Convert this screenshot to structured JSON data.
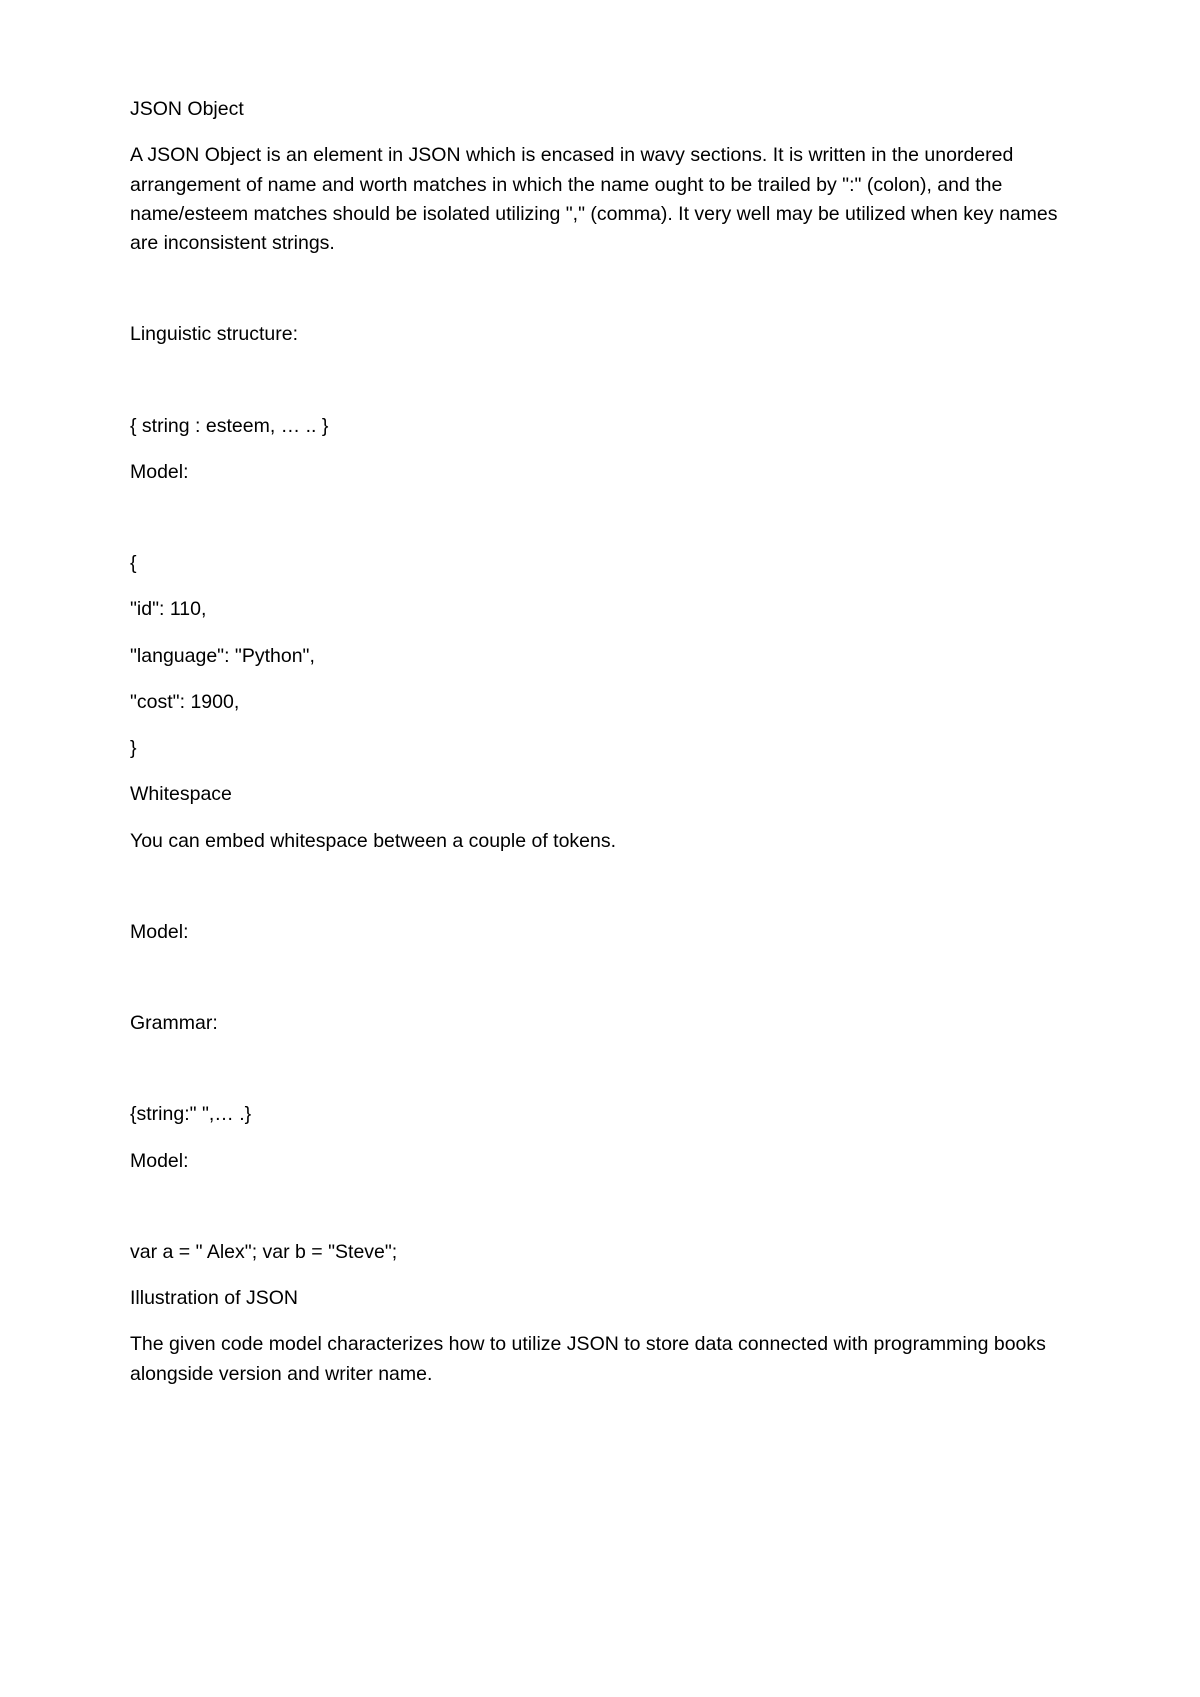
{
  "heading": "JSON Object",
  "intro": "A JSON Object is an element in JSON which is encased in wavy sections. It is written in the unordered arrangement of name and worth matches in which the name ought to be trailed by \":\" (colon), and the name/esteem matches should be isolated utilizing \",\" (comma). It very well may be utilized when key names are inconsistent strings.",
  "structure_label": "Linguistic structure:",
  "structure_syntax": "{ string : esteem, … .. }",
  "model_label_1": "Model:",
  "example_open": "{",
  "example_id": "\"id\": 110,",
  "example_language": "\"language\": \"Python\",",
  "example_cost": "\"cost\": 1900,",
  "example_close": "}",
  "whitespace_heading": "Whitespace",
  "whitespace_desc": "You can embed whitespace between a couple of tokens.",
  "model_label_2": "Model:",
  "grammar_label": "Grammar:",
  "grammar_syntax": "{string:\" \",… .}",
  "model_label_3": "Model:",
  "var_example": "var a = \" Alex\"; var b = \"Steve\";",
  "illustration_heading": "Illustration of JSON",
  "illustration_desc": "The given code model characterizes how to utilize JSON to store data connected with programming books alongside version and writer name."
}
